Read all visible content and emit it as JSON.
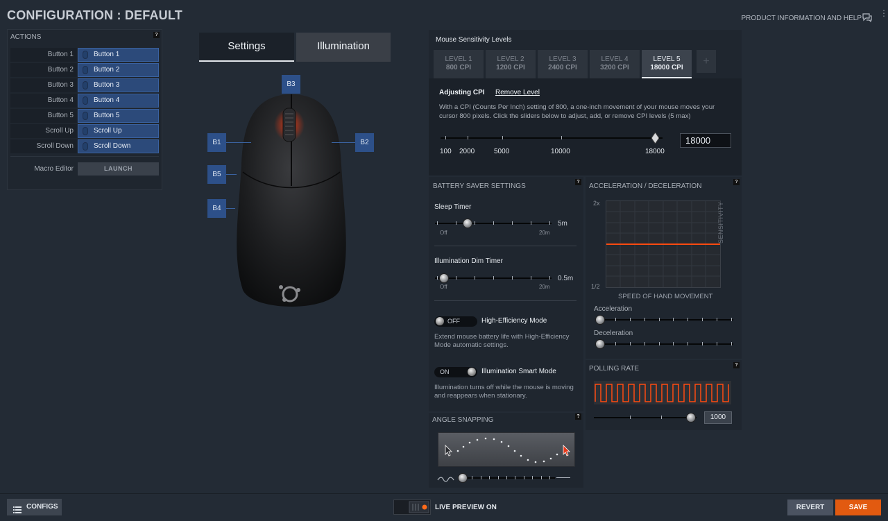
{
  "header": {
    "title": "CONFIGURATION : DEFAULT",
    "help_link": "PRODUCT INFORMATION AND HELP"
  },
  "actions": {
    "title": "ACTIONS",
    "help": "?",
    "rows": [
      {
        "label": "Button 1",
        "value": "Button 1"
      },
      {
        "label": "Button 2",
        "value": "Button 2"
      },
      {
        "label": "Button 3",
        "value": "Button 3"
      },
      {
        "label": "Button 4",
        "value": "Button 4"
      },
      {
        "label": "Button 5",
        "value": "Button 5"
      },
      {
        "label": "Scroll Up",
        "value": "Scroll Up"
      },
      {
        "label": "Scroll Down",
        "value": "Scroll Down"
      }
    ],
    "macro_label": "Macro Editor",
    "macro_button": "LAUNCH"
  },
  "tabs": {
    "settings": "Settings",
    "illumination": "Illumination"
  },
  "mouse_view": {
    "tags": [
      "B3",
      "B1",
      "B2",
      "B5",
      "B4"
    ]
  },
  "sensitivity": {
    "title": "Mouse Sensitivity Levels",
    "levels": [
      {
        "name": "LEVEL 1",
        "cpi": "800 CPI"
      },
      {
        "name": "LEVEL 2",
        "cpi": "1200 CPI"
      },
      {
        "name": "LEVEL 3",
        "cpi": "2400 CPI"
      },
      {
        "name": "LEVEL 4",
        "cpi": "3200 CPI"
      },
      {
        "name": "LEVEL 5",
        "cpi": "18000 CPI"
      }
    ],
    "active_level": 5,
    "add_label": "+",
    "adjusting_label": "Adjusting CPI",
    "remove_label": "Remove Level",
    "description": "With a CPI (Counts Per Inch) setting of 800, a one-inch movement of your mouse moves your cursor 800 pixels. Click the sliders below to adjust, add, or remove CPI levels (5 max)",
    "slider_ticks": [
      "100",
      "2000",
      "5000",
      "10000",
      "18000"
    ],
    "value": "18000"
  },
  "battery": {
    "title": "BATTERY SAVER SETTINGS",
    "help": "?",
    "sleep_label": "Sleep Timer",
    "sleep_value": "5m",
    "sleep_min": "Off",
    "sleep_max": "20m",
    "dim_label": "Illumination Dim Timer",
    "dim_value": "0.5m",
    "dim_min": "Off",
    "dim_max": "20m",
    "he_state": "OFF",
    "he_label": "High-Efficiency Mode",
    "he_desc": "Extend mouse battery life with High-Efficiency Mode automatic settings.",
    "smart_state": "ON",
    "smart_label": "Illumination Smart Mode",
    "smart_desc": "Illumination turns off while the mouse is moving and reappears when stationary."
  },
  "accel": {
    "title": "ACCELERATION / DECELERATION",
    "help": "?",
    "y_top": "2x",
    "y_bottom": "1/2",
    "y_label": "SENSITIVITY",
    "x_label": "SPEED OF HAND MOVEMENT",
    "accel_label": "Acceleration",
    "decel_label": "Deceleration"
  },
  "polling": {
    "title": "POLLING RATE",
    "help": "?",
    "value": "1000"
  },
  "angle": {
    "title": "ANGLE SNAPPING",
    "help": "?"
  },
  "bottom": {
    "configs": "CONFIGS",
    "live_preview": "LIVE PREVIEW ON",
    "revert": "REVERT",
    "save": "SAVE"
  },
  "colors": {
    "accent_orange": "#e25a10",
    "button_blue": "#2c4a7a",
    "graph_line": "#ff4a10"
  }
}
